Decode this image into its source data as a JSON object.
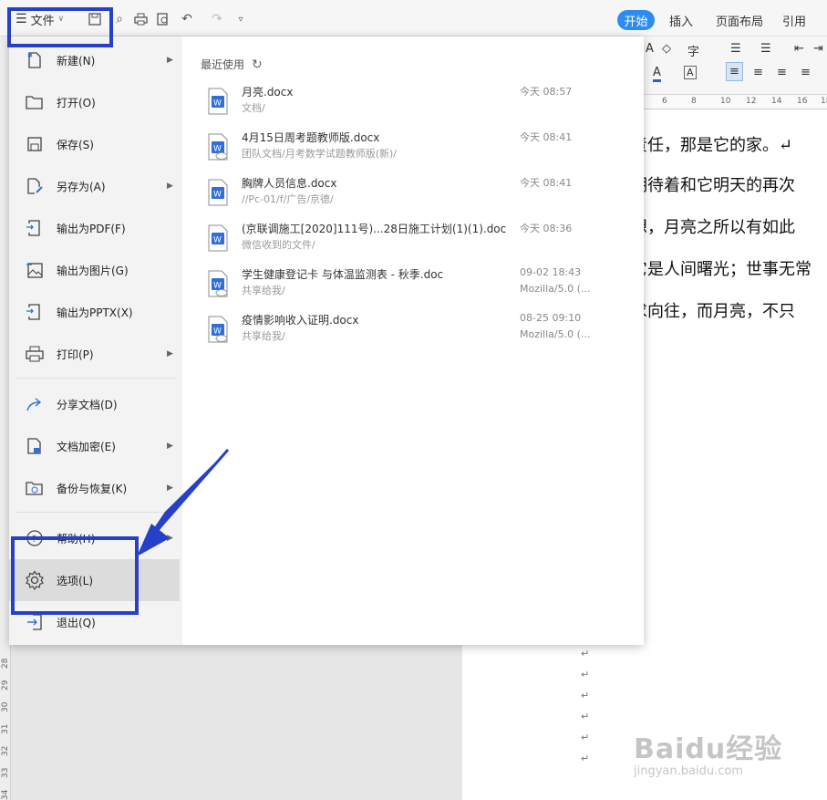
{
  "toolbar": {
    "file_label": "文件",
    "tabs": [
      "开始",
      "插入",
      "页面布局",
      "引用"
    ]
  },
  "ruler": [
    "6",
    "8",
    "10",
    "12",
    "14",
    "16",
    "18"
  ],
  "left_ruler": [
    "28",
    "29",
    "30",
    "31",
    "32",
    "33",
    "34"
  ],
  "document": {
    "lines": [
      "责任，那是它的家。↵",
      "期待着和它明天的再次",
      "想，月亮之所以有如此",
      "它是人间曙光；世事无常",
      "求向往，而月亮，不只"
    ],
    "para_mark": "↵"
  },
  "menu": {
    "items": [
      {
        "label": "新建(N)",
        "icon": "new-doc-icon",
        "submenu": true
      },
      {
        "label": "打开(O)",
        "icon": "folder-open-icon",
        "submenu": false
      },
      {
        "label": "保存(S)",
        "icon": "save-icon",
        "submenu": false
      },
      {
        "label": "另存为(A)",
        "icon": "save-as-icon",
        "submenu": true
      },
      {
        "label": "输出为PDF(F)",
        "icon": "export-pdf-icon",
        "submenu": false
      },
      {
        "label": "输出为图片(G)",
        "icon": "export-image-icon",
        "submenu": false
      },
      {
        "label": "输出为PPTX(X)",
        "icon": "export-pptx-icon",
        "submenu": false
      },
      {
        "label": "打印(P)",
        "icon": "print-icon",
        "submenu": true
      },
      {
        "label": "分享文档(D)",
        "icon": "share-icon",
        "submenu": false
      },
      {
        "label": "文档加密(E)",
        "icon": "encrypt-icon",
        "submenu": true
      },
      {
        "label": "备份与恢复(K)",
        "icon": "backup-icon",
        "submenu": true
      },
      {
        "label": "帮助(H)",
        "icon": "help-icon",
        "submenu": true
      },
      {
        "label": "选项(L)",
        "icon": "gear-icon",
        "submenu": false
      },
      {
        "label": "退出(Q)",
        "icon": "exit-icon",
        "submenu": false
      }
    ],
    "recent_title": "最近使用",
    "recent": [
      {
        "name": "月亮.docx",
        "path": "文档/",
        "time": "今天 08:57",
        "source": ""
      },
      {
        "name": "4月15日周考题教师版.docx",
        "path": "团队文档/月考数学试题教师版(新)/",
        "time": "今天 08:41",
        "source": ""
      },
      {
        "name": "胸牌人员信息.docx",
        "path": "//Pc-01/f/广告/京德/",
        "time": "今天 08:41",
        "source": ""
      },
      {
        "name": "(京联调施工[2020]111号)...28日施工计划(1)(1).doc",
        "path": "微信收到的文件/",
        "time": "今天 08:36",
        "source": ""
      },
      {
        "name": "学生健康登记卡 与体温监测表 - 秋季.doc",
        "path": "共享给我/",
        "time": "09-02 18:43",
        "source": "Mozilla/5.0 (..."
      },
      {
        "name": "疫情影响收入证明.docx",
        "path": "共享给我/",
        "time": "08-25 09:10",
        "source": "Mozilla/5.0 (..."
      }
    ]
  },
  "watermark": {
    "brand": "Baidu经验",
    "url": "jingyan.baidu.com"
  },
  "colors": {
    "accent": "#2d8cf0",
    "annotation": "#2740c8",
    "doc_icon": "#2f6fd6"
  }
}
